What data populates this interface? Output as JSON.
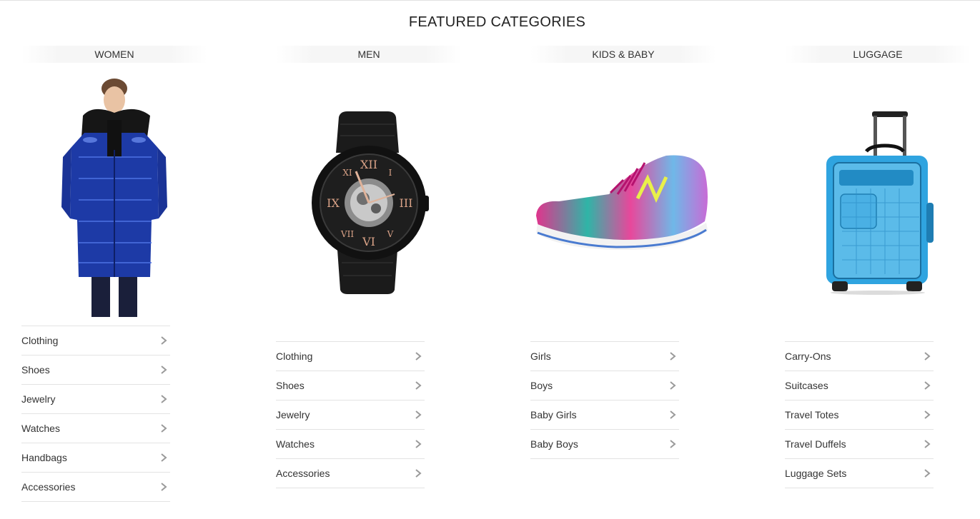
{
  "title": "FEATURED CATEGORIES",
  "categories": [
    {
      "name": "WOMEN",
      "image": "woman-in-blue-puffer-coat",
      "links": [
        "Clothing",
        "Shoes",
        "Jewelry",
        "Watches",
        "Handbags",
        "Accessories"
      ]
    },
    {
      "name": "MEN",
      "image": "black-skeleton-wristwatch",
      "links": [
        "Clothing",
        "Shoes",
        "Jewelry",
        "Watches",
        "Accessories"
      ]
    },
    {
      "name": "KIDS & BABY",
      "image": "rainbow-running-shoe",
      "links": [
        "Girls",
        "Boys",
        "Baby Girls",
        "Baby Boys"
      ]
    },
    {
      "name": "LUGGAGE",
      "image": "blue-carry-on-suitcase",
      "links": [
        "Carry-Ons",
        "Suitcases",
        "Travel Totes",
        "Travel Duffels",
        "Luggage Sets"
      ]
    }
  ],
  "icons": {
    "link_arrow": "chevron-right-icon"
  }
}
